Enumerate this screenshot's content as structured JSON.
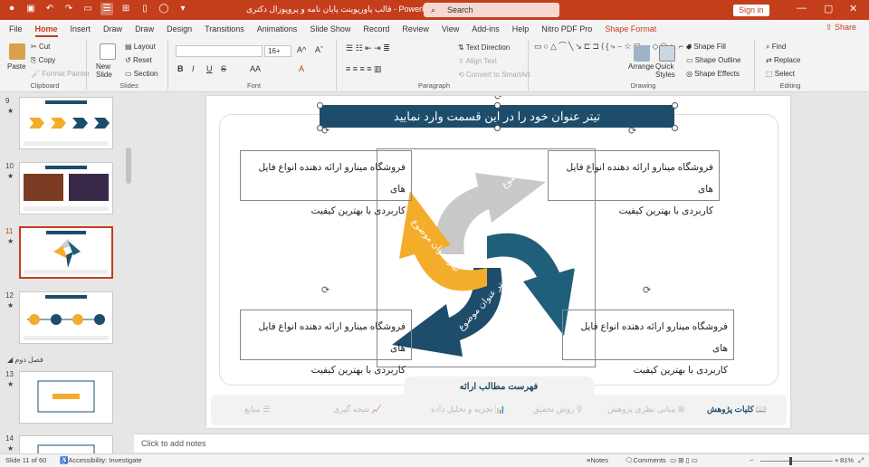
{
  "window": {
    "title": "قالب پاورپوینت پایان نامه و پروپوزال دکتری  -  PowerPoint",
    "search_placeholder": "Search",
    "signin": "Sign in"
  },
  "tabs": [
    "File",
    "Home",
    "Insert",
    "Draw",
    "Draw",
    "Design",
    "Transitions",
    "Animations",
    "Slide Show",
    "Record",
    "Review",
    "View",
    "Add-ins",
    "Help",
    "Nitro PDF Pro",
    "Shape Format"
  ],
  "share": "Share",
  "ribbon": {
    "clipboard": {
      "paste": "Paste",
      "cut": "Cut",
      "copy": "Copy",
      "format_painter": "Format Painter",
      "label": "Clipboard"
    },
    "slides": {
      "new_slide": "New Slide",
      "layout": "Layout",
      "reset": "Reset",
      "section": "Section",
      "label": "Slides"
    },
    "font": {
      "font_name": "",
      "font_size": "16+",
      "label": "Font",
      "bold": "B",
      "italic": "I",
      "underline": "U",
      "strike": "S",
      "aa": "AA"
    },
    "paragraph": {
      "text_direction": "Text Direction",
      "align_text": "Align Text",
      "convert_smartart": "Convert to SmartArt",
      "label": "Paragraph"
    },
    "drawing": {
      "arrange": "Arrange",
      "quick_styles": "Quick Styles",
      "shape_fill": "Shape Fill",
      "shape_outline": "Shape Outline",
      "shape_effects": "Shape Effects",
      "label": "Drawing"
    },
    "editing": {
      "find": "Find",
      "replace": "Replace",
      "select": "Select",
      "label": "Editing"
    }
  },
  "thumbnails": {
    "numbers": [
      "9",
      "10",
      "11",
      "12",
      "13",
      "14"
    ],
    "section_label": "فصل دوم"
  },
  "slide": {
    "title": "تیتر عنوان خود را در این قسمت وارد نمایید",
    "box_line1": "فروشگاه مینارو ارائه دهنده انواع فایل های",
    "box_line2": "کاربردی با بهترین کیفیت",
    "arrow_label": "تیتر عنوان موضوع",
    "bottom_title": "فهرست مطالب ارائه",
    "nav": [
      "کلیات پژوهش",
      "مبانی نظری پژوهش",
      "روش تحقیق",
      "تجزیه و تحلیل داده",
      "نتیجه گیری",
      "منابع"
    ]
  },
  "colors": {
    "brand": "#c43e1c",
    "navy": "#1d4d6b",
    "teal": "#1f5f7a",
    "gray_arrow": "#c9c9c9",
    "gold": "#f3ad2a"
  },
  "notes_placeholder": "Click to add notes",
  "status": {
    "slide": "Slide 11 of 60",
    "accessibility": "Accessibility: Investigate",
    "notes": "Notes",
    "comments": "Comments",
    "zoom": "81%"
  }
}
